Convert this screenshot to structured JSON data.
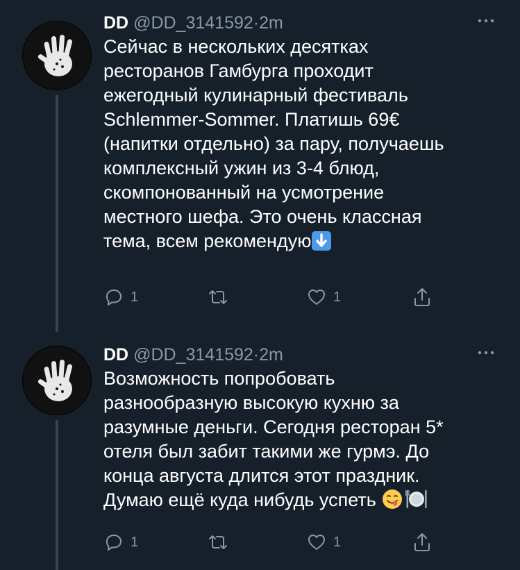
{
  "tweets": [
    {
      "name": "DD",
      "handle": "@DD_3141592",
      "separator": "·",
      "time": "2m",
      "lines": [
        "Сейчас в нескольких десятках",
        "ресторанов Гамбурга проходит",
        "ежегодный кулинарный фестиваль",
        "Schlemmer-Sommer. Платишь 69€",
        "(напитки отдельно) за пару, получаешь",
        "комплексный ужин из 3-4 блюд,",
        "скомпонованный на усмотрение",
        "местного шефа. Это очень классная",
        "тема, всем рекомендую"
      ],
      "trailing_emoji": "down-arrow-emoji",
      "reply_count": "1",
      "retweet_count": "",
      "like_count": "1"
    },
    {
      "name": "DD",
      "handle": "@DD_3141592",
      "separator": "·",
      "time": "2m",
      "lines": [
        "Возможность попробовать",
        "разнообразную высокую кухню за",
        "разумные деньги. Сегодня ресторан 5*",
        "отеля был забит такими же гурмэ. До",
        "конца августа длится этот праздник.",
        "Думаю ещё куда нибудь успеть "
      ],
      "trailing_emoji": "yum-face-emoji, plate-cutlery-emoji",
      "reply_count": "1",
      "retweet_count": "",
      "like_count": "1"
    }
  ],
  "icons": {
    "avatar": "hand-avatar",
    "more": "more-dots-icon",
    "reply": "reply-icon",
    "retweet": "retweet-icon",
    "like": "heart-icon",
    "share": "share-icon"
  },
  "colors": {
    "background": "#15202b",
    "secondary_text": "#8899a6",
    "thread_line": "#38444d",
    "primary_text": "#ffffff"
  }
}
